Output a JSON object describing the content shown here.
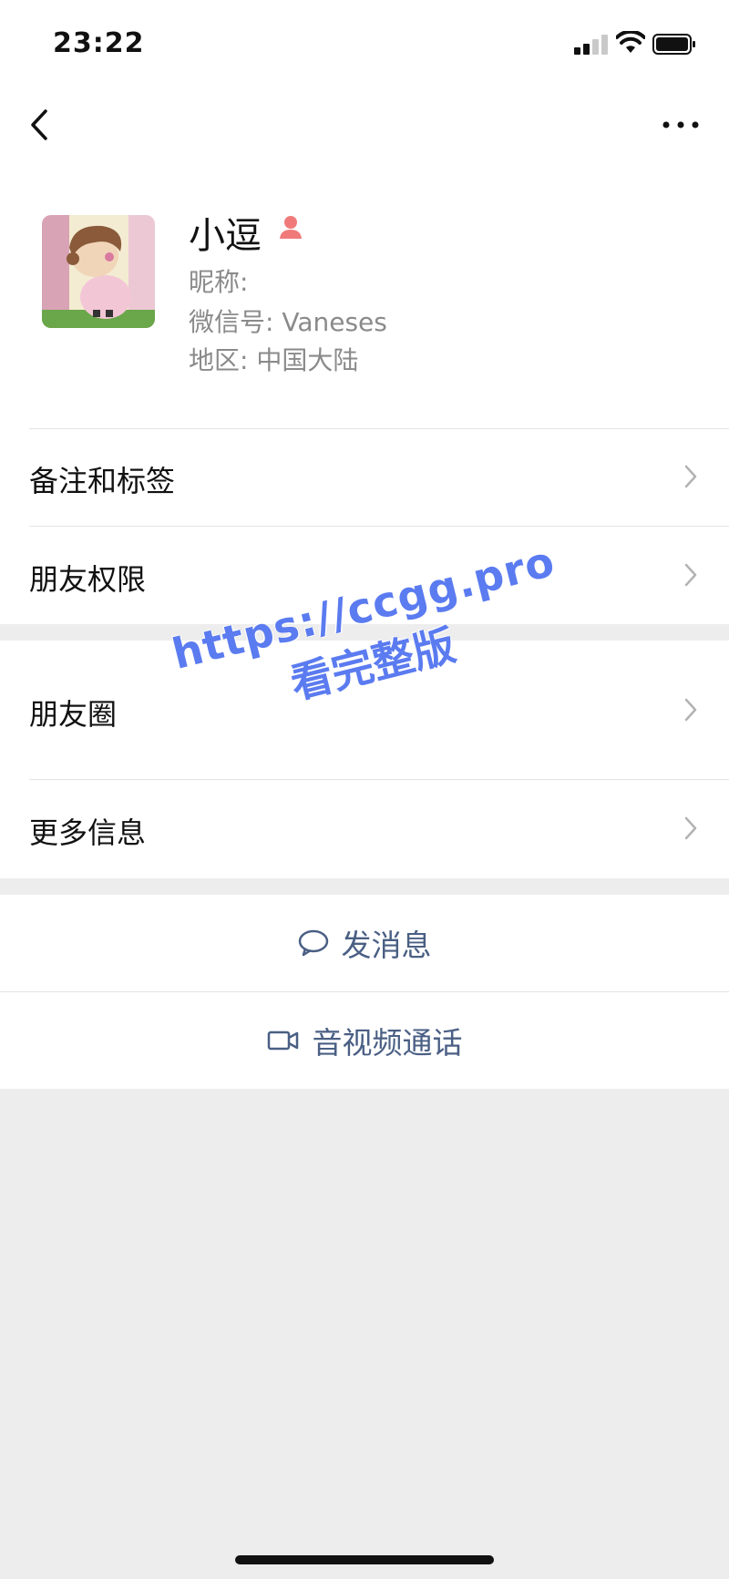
{
  "status_bar": {
    "time": "23:22"
  },
  "profile": {
    "name": "小逗",
    "nickname": "昵称:",
    "wechat_id": "微信号: Vaneses",
    "region": "地区: 中国大陆"
  },
  "rows": {
    "remarks_tags": "备注和标签",
    "friend_permissions": "朋友权限",
    "moments": "朋友圈",
    "more_info": "更多信息"
  },
  "actions": {
    "send_message": "发消息",
    "video_call": "音视频通话"
  },
  "watermark": {
    "line1": "https://ccgg.pro",
    "line2": "看完整版"
  },
  "colors": {
    "action_text": "#4a5f84",
    "background": "#ededed",
    "watermark": "#5b7bf0",
    "gender_icon": "#f07a7a"
  }
}
